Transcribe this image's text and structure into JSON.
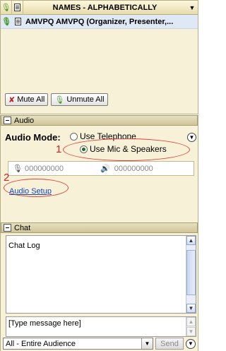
{
  "participants": {
    "header_title": "NAMES - ALPHABETICALLY",
    "row_name": "AMVPQ AMVPQ (Organizer, Presenter,...",
    "mute_all_label": "Mute All",
    "unmute_all_label": "Unmute All"
  },
  "audio": {
    "section_label": "Audio",
    "mode_label": "Audio Mode:",
    "option_telephone": "Use Telephone",
    "option_mic": "Use Mic & Speakers",
    "mic_level": "000000000",
    "speaker_level": "000000000",
    "setup_link": "Audio Setup",
    "annotation_1": "1",
    "annotation_2": "2"
  },
  "chat": {
    "section_label": "Chat",
    "log_label": "Chat Log",
    "message_placeholder": "[Type message here]",
    "audience_selected": "All - Entire Audience",
    "send_label": "Send"
  }
}
